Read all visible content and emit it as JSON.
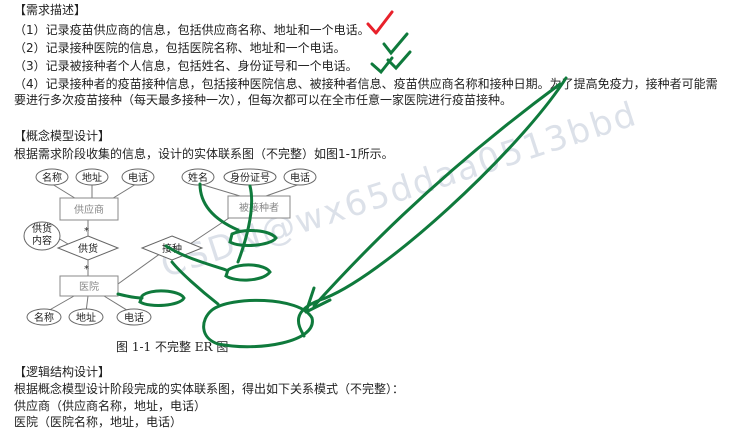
{
  "doc": {
    "sec_req": "【需求描述】",
    "req1": "（1）记录疫苗供应商的信息，包括供应商名称、地址和一个电话。",
    "req2": "（2）记录接种医院的信息，包括医院名称、地址和一个电话。",
    "req3": "（3）记录被接种者个人信息，包括姓名、身份证号和一个电话。",
    "req4": "（4）记录接种者的疫苗接种信息，包括接种医院信息、被接种者信息、疫苗供应商名称和接种日期。为了提高免疫力，接种者可能需要进行多次疫苗接种（每天最多接种一次），但每次都可以在全市任意一家医院进行疫苗接种。",
    "sec_concept": "【概念模型设计】",
    "concept_text": "根据需求阶段收集的信息，设计的实体联系图（不完整）如图1-1所示。",
    "caption": "图 1-1  不完整 ER 图",
    "sec_logic": "【逻辑结构设计】",
    "logic_text": "根据概念模型设计阶段完成的实体联系图，得出如下关系模式（不完整）：",
    "rel1": "供应商（供应商名称，地址，电话）",
    "rel2": "医院（医院名称，地址，电话）"
  },
  "er": {
    "entity_supplier": "供应商",
    "entity_hospital": "医院",
    "entity_person": "被接种者",
    "rel_supply": "供货",
    "rel_vaccinate": "接种",
    "attr_sup_name": "名称",
    "attr_sup_addr": "地址",
    "attr_sup_phone": "电话",
    "attr_supply_content": "供货\n内容",
    "attr_hos_name": "名称",
    "attr_hos_addr": "地址",
    "attr_hos_phone": "电话",
    "attr_p_name": "姓名",
    "attr_p_id": "身份证号",
    "attr_p_phone": "电话",
    "card_star_top": "*",
    "card_star_bottom": "*"
  },
  "watermark": "CSDN@wx65ddaa0513bbd",
  "colors": {
    "check_red": "#e8212b",
    "annotation_green": "#0f7a3c"
  }
}
